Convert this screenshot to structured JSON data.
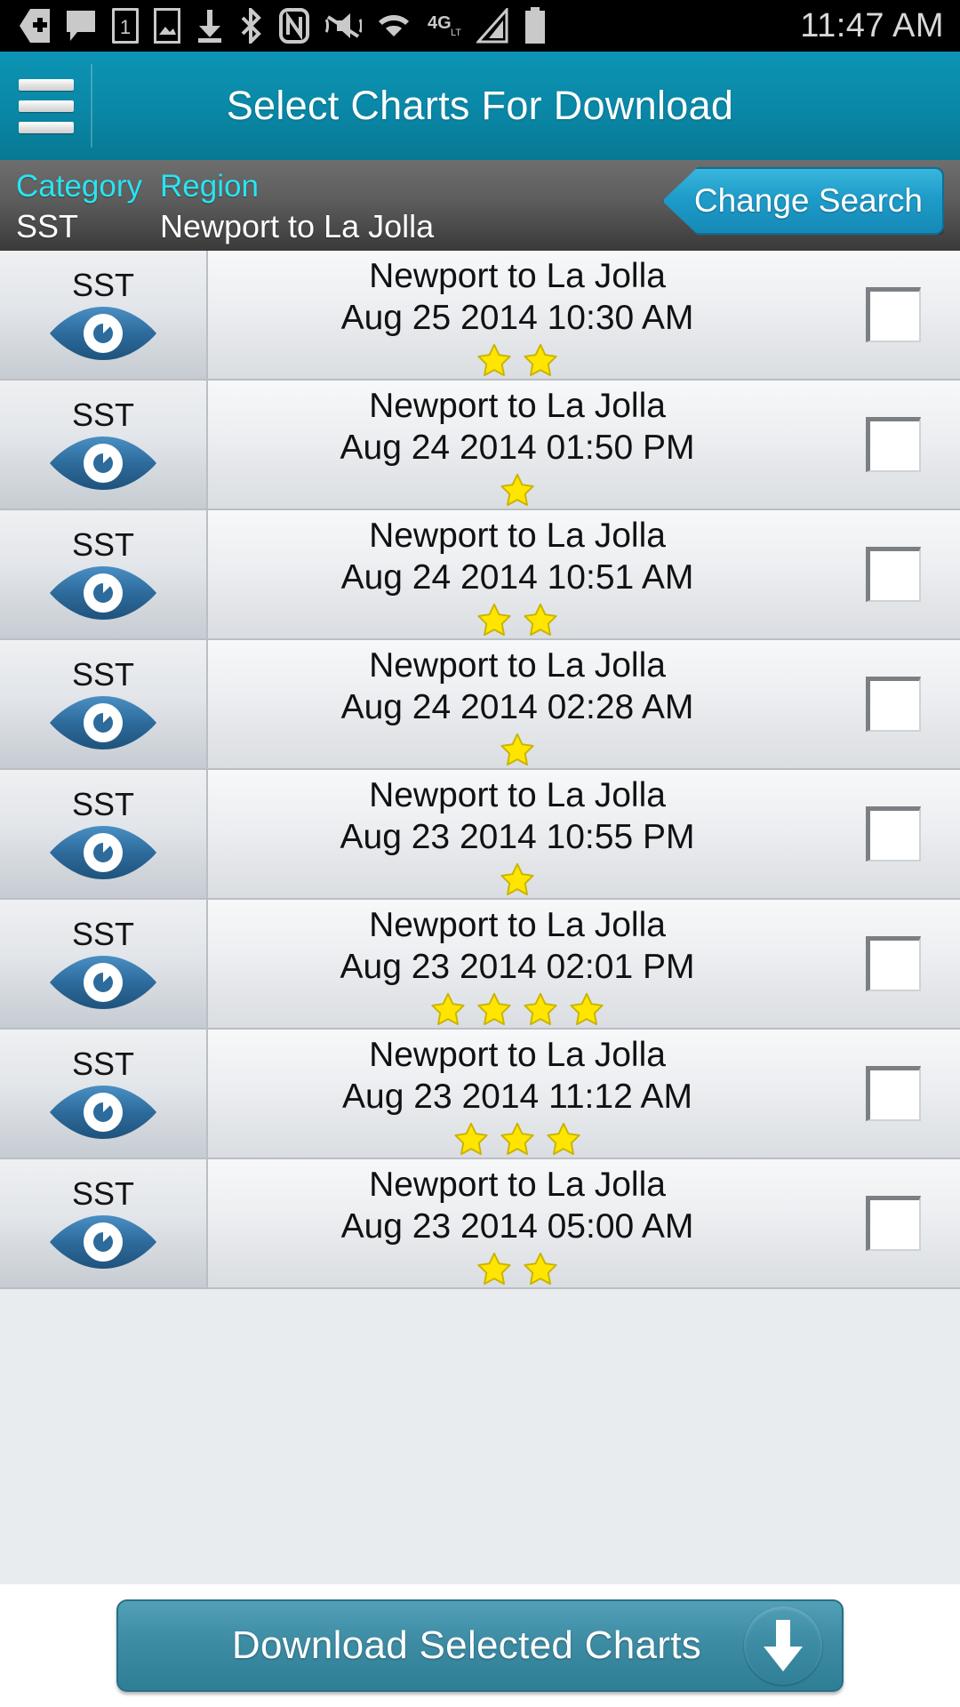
{
  "status_bar": {
    "time": "11:47 AM",
    "icons": [
      "add-contact-icon",
      "message-icon",
      "sim-card-1-icon",
      "image-icon",
      "download-icon",
      "bluetooth-icon",
      "nfc-icon",
      "vibrate-mute-icon",
      "wifi-icon",
      "4g-lte-icon",
      "signal-bars-icon",
      "battery-icon"
    ]
  },
  "header": {
    "title": "Select Charts For Download",
    "menu_icon": "hamburger-menu-icon"
  },
  "search_summary": {
    "category_label": "Category",
    "category_value": "SST",
    "region_label": "Region",
    "region_value": "Newport to La Jolla",
    "change_search_label": "Change Search"
  },
  "list": {
    "rows": [
      {
        "category": "SST",
        "name": "Newport to La Jolla",
        "date": "Aug 25 2014 10:30 AM",
        "stars": 2,
        "checked": false
      },
      {
        "category": "SST",
        "name": "Newport to La Jolla",
        "date": "Aug 24 2014 01:50 PM",
        "stars": 1,
        "checked": false
      },
      {
        "category": "SST",
        "name": "Newport to La Jolla",
        "date": "Aug 24 2014 10:51 AM",
        "stars": 2,
        "checked": false
      },
      {
        "category": "SST",
        "name": "Newport to La Jolla",
        "date": "Aug 24 2014 02:28 AM",
        "stars": 1,
        "checked": false
      },
      {
        "category": "SST",
        "name": "Newport to La Jolla",
        "date": "Aug 23 2014 10:55 PM",
        "stars": 1,
        "checked": false
      },
      {
        "category": "SST",
        "name": "Newport to La Jolla",
        "date": "Aug 23 2014 02:01 PM",
        "stars": 4,
        "checked": false
      },
      {
        "category": "SST",
        "name": "Newport to La Jolla",
        "date": "Aug 23 2014 11:12 AM",
        "stars": 3,
        "checked": false
      },
      {
        "category": "SST",
        "name": "Newport to La Jolla",
        "date": "Aug 23 2014 05:00 AM",
        "stars": 2,
        "checked": false
      }
    ]
  },
  "bottom_bar": {
    "download_label": "Download Selected Charts",
    "download_icon": "download-arrow-icon"
  },
  "colors": {
    "header_teal": "#0a87a6",
    "accent_cyan": "#29e4f2",
    "search_bar_gray": "#5e5e5e",
    "button_blue": "#1e9cc9",
    "download_button": "#3d8ca4",
    "star_yellow": "#ffe500",
    "eye_blue": "#2f6f9e"
  }
}
